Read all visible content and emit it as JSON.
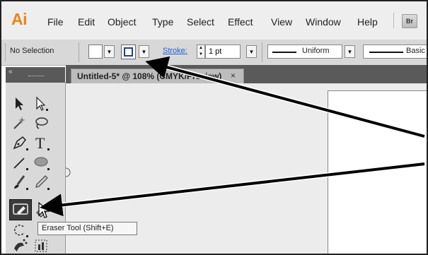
{
  "app": {
    "logo": "Ai",
    "menu": [
      "File",
      "Edit",
      "Object",
      "Type",
      "Select",
      "Effect",
      "View",
      "Window",
      "Help"
    ],
    "bridge_button": "Br"
  },
  "control_bar": {
    "selection": "No Selection",
    "stroke_label": "Stroke:",
    "stroke_weight": "1 pt",
    "profile": "Uniform",
    "brush": "Basic"
  },
  "document": {
    "tab_title": "Untitled-5* @ 108% (CMYK/Preview)",
    "tab_close": "×"
  },
  "tooltip": {
    "text": "Eraser Tool (Shift+E)"
  },
  "tools": [
    "selection-tool",
    "direct-selection-tool",
    "magic-wand-tool",
    "lasso-tool",
    "pen-tool",
    "type-tool",
    "line-segment-tool",
    "ellipse-tool",
    "paintbrush-tool",
    "pencil-tool",
    "blob-brush-tool",
    "eraser-tool",
    "rotate-tool",
    "scale-tool",
    "symbol-sprayer-tool",
    "column-graph-tool"
  ],
  "colors": {
    "accent_orange": "#e8851b",
    "stroke_link": "#1f5fd6",
    "annotation_arrow": "#000000"
  }
}
